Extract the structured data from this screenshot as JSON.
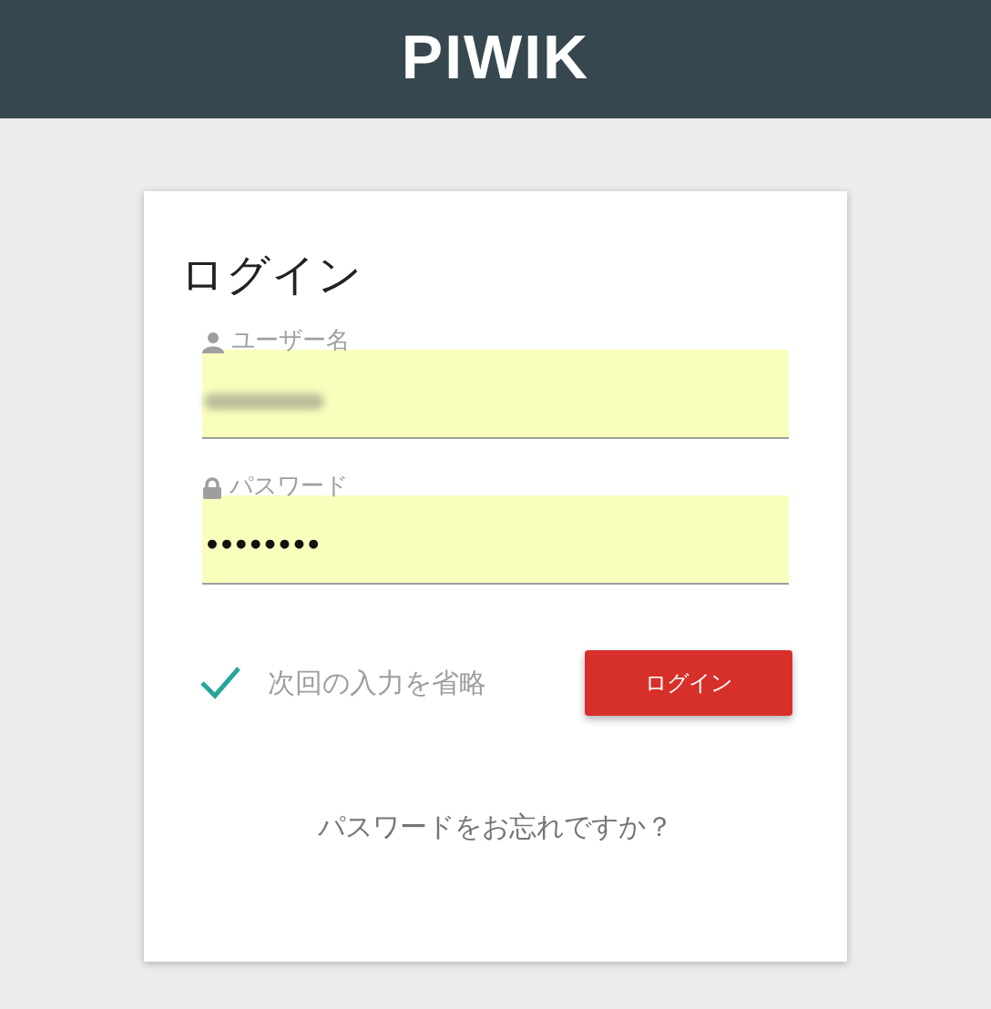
{
  "header": {
    "logo": "PIWIK"
  },
  "login": {
    "title": "ログイン",
    "fields": [
      {
        "kind": "user",
        "label": "ユーザー名",
        "value_blurred": true
      },
      {
        "kind": "lock",
        "label": "パスワード",
        "value": "••••••••"
      }
    ],
    "remember": {
      "label": "次回の入力を省略",
      "checked": true
    },
    "submit": "ログイン",
    "forgot_link": "パスワードをお忘れですか？"
  }
}
